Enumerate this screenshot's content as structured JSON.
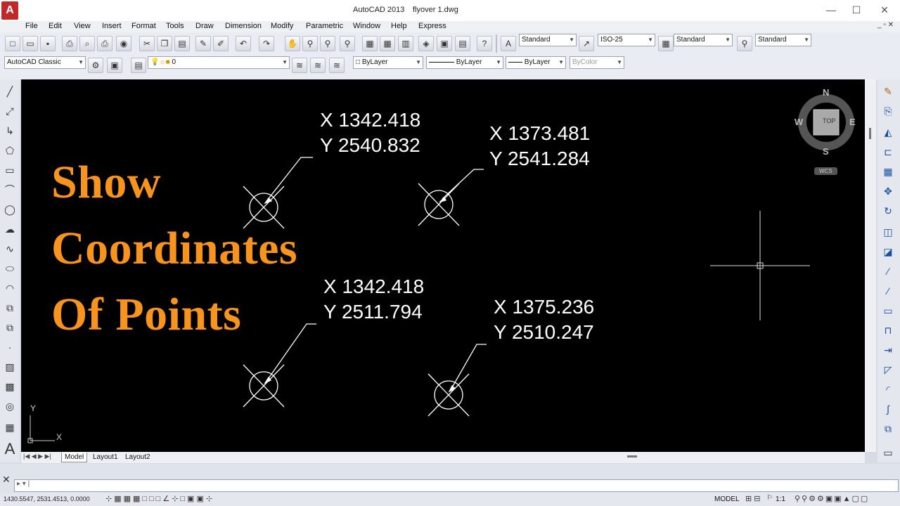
{
  "title": {
    "app": "AutoCAD 2013",
    "file": "flyover 1.dwg",
    "logo_letter": "A"
  },
  "window_controls": {
    "minimize": "—",
    "maximize": "☐",
    "close": "✕"
  },
  "menu": [
    "File",
    "Edit",
    "View",
    "Insert",
    "Format",
    "Tools",
    "Draw",
    "Dimension",
    "Modify",
    "Parametric",
    "Window",
    "Help",
    "Express"
  ],
  "styles": {
    "text_style": "Standard",
    "dim_style": "ISO-25",
    "table_style": "Standard",
    "mleader_style": "Standard"
  },
  "workspace": "AutoCAD Classic",
  "layer": "0",
  "properties": {
    "color": "ByLayer",
    "linetype": "ByLayer",
    "lineweight": "ByLayer",
    "plotstyle": "ByColor"
  },
  "viewcube": {
    "top": "TOP",
    "n": "N",
    "s": "S",
    "e": "E",
    "w": "W",
    "wcs": "WCS"
  },
  "headline": [
    "Show",
    "Coordinates",
    "Of Points"
  ],
  "points": [
    {
      "x_label": "X 1342.418",
      "y_label": "Y 2540.832"
    },
    {
      "x_label": "X 1373.481",
      "y_label": "Y 2541.284"
    },
    {
      "x_label": "X 1342.418",
      "y_label": "Y 2511.794"
    },
    {
      "x_label": "X 1375.236",
      "y_label": "Y 2510.247"
    }
  ],
  "ucs": {
    "x": "X",
    "y": "Y"
  },
  "tabs": [
    "Model",
    "Layout1",
    "Layout2"
  ],
  "status": {
    "coordinates": "1430.5547, 2531.4513, 0.0000",
    "model": "MODEL",
    "scale": "1:1"
  },
  "colors": {
    "canvas": "#000000",
    "headline": "#f7941d",
    "text": "#ffffff"
  }
}
